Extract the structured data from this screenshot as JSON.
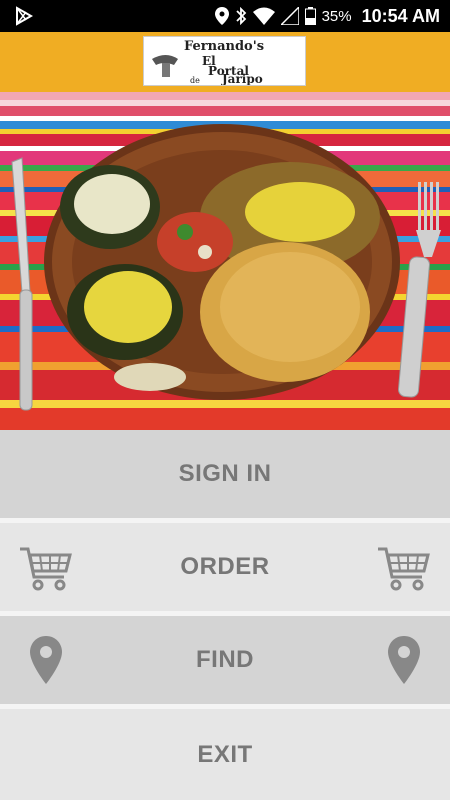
{
  "status_bar": {
    "battery": "35%",
    "time": "10:54 AM",
    "icons": [
      "play-store-icon",
      "location-icon",
      "bluetooth-icon",
      "wifi-icon",
      "signal-icon",
      "battery-icon"
    ]
  },
  "header": {
    "logo": {
      "line1": "Fernando's",
      "line2": "El",
      "line3": "Portal",
      "line4": "de",
      "line5": "Jaripo"
    },
    "background_color": "#f0ad23"
  },
  "hero": {
    "image": "plate-of-mexican-food"
  },
  "menu": {
    "sign_in": {
      "label": "SIGN IN"
    },
    "order": {
      "label": "ORDER",
      "icon": "shopping-cart-icon"
    },
    "find": {
      "label": "FIND",
      "icon": "map-pin-icon"
    },
    "exit": {
      "label": "EXIT"
    }
  }
}
